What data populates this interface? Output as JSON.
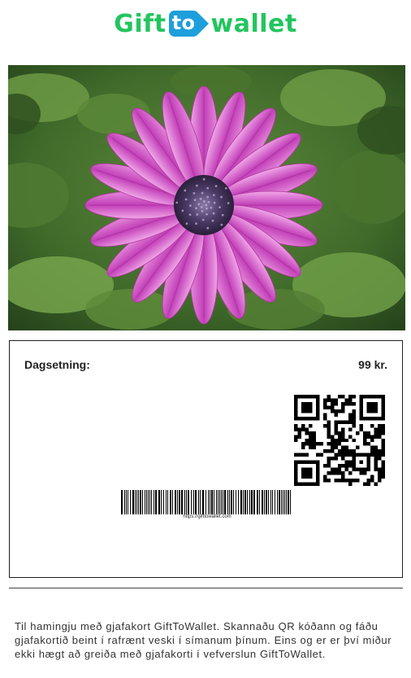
{
  "logo": {
    "part1": "Gift",
    "part2": "to",
    "part3": "wallet"
  },
  "card": {
    "date_label": "Dagsetning:",
    "price": "99 kr.",
    "barcode_url": "https://gifttowallet.com"
  },
  "message": "Til hamingju með gjafakort GiftToWallet. Skannaðu QR kóðann og fáðu gjafakortið beint í rafrænt veski í símanum þínum. Eins og er er því miður ekki hægt að greiða með gjafakorti í vefverslun GiftToWallet.",
  "colors": {
    "logo_green": "#22c55e",
    "logo_blue": "#1e9fdc",
    "petal": "#d04fc4",
    "foliage": "#4f7a32"
  },
  "icons": {
    "logo": "gifttowallet-logo",
    "qr": "qr-code-icon",
    "barcode": "barcode-icon"
  }
}
